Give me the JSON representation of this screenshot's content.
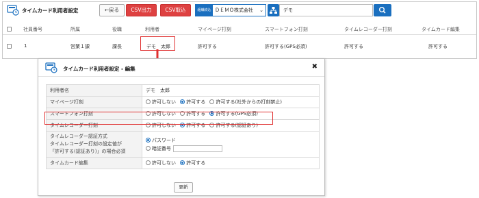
{
  "header": {
    "title": "タイムカード利用者設定",
    "back_label": "←戻る",
    "csv_export_label": "CSV出力",
    "csv_import_label": "CSV取込",
    "org_label": "組織絞込",
    "org_value": "ＤＥＭＯ株式会社",
    "search_value": "デモ"
  },
  "table": {
    "columns": [
      "社員番号",
      "所属",
      "役職",
      "利用者",
      "マイページ打刻",
      "スマートフォン打刻",
      "タイムレコーダー打刻",
      "タイムカード編集"
    ],
    "rows": [
      {
        "employee_no": "1",
        "department": "営業１課",
        "position": "課長",
        "user": "デモ　太郎",
        "mypage": "許可する",
        "smartphone": "許可する(GPS必須)",
        "recorder": "許可する",
        "edit": "許可する"
      }
    ]
  },
  "modal": {
    "title": "タイムカード利用者設定 - 編集",
    "close_symbol": "✖",
    "user_label": "利用者名",
    "user_name": "デモ　太郎",
    "mypage_label": "マイページ打刻",
    "mypage_options": [
      "許可しない",
      "許可する",
      "許可する(社外からの打刻禁止)"
    ],
    "mypage_selected": 1,
    "smartphone_label": "スマートフォン打刻",
    "smartphone_options": [
      "許可しない",
      "許可する",
      "許可する(GPS必須)"
    ],
    "smartphone_selected": 2,
    "recorder_label": "タイムレコーダー打刻",
    "recorder_options": [
      "許可しない",
      "許可する",
      "許可する(認証あり)"
    ],
    "recorder_selected": 1,
    "auth_label": "タイムレコーダー認証方式",
    "auth_note_1": "タイムレコーダー打刻の設定値が",
    "auth_note_2": "「許可する(認証あり)」の場合必須",
    "auth_options": [
      "パスワード",
      "暗証番号"
    ],
    "auth_selected": 0,
    "edit_label": "タイムカード編集",
    "edit_options": [
      "許可しない",
      "許可する"
    ],
    "edit_selected": 1,
    "update_label": "更新"
  },
  "colors": {
    "accent": "#1a6fbf",
    "csv_button": "#de4141",
    "highlight": "#e03030"
  }
}
